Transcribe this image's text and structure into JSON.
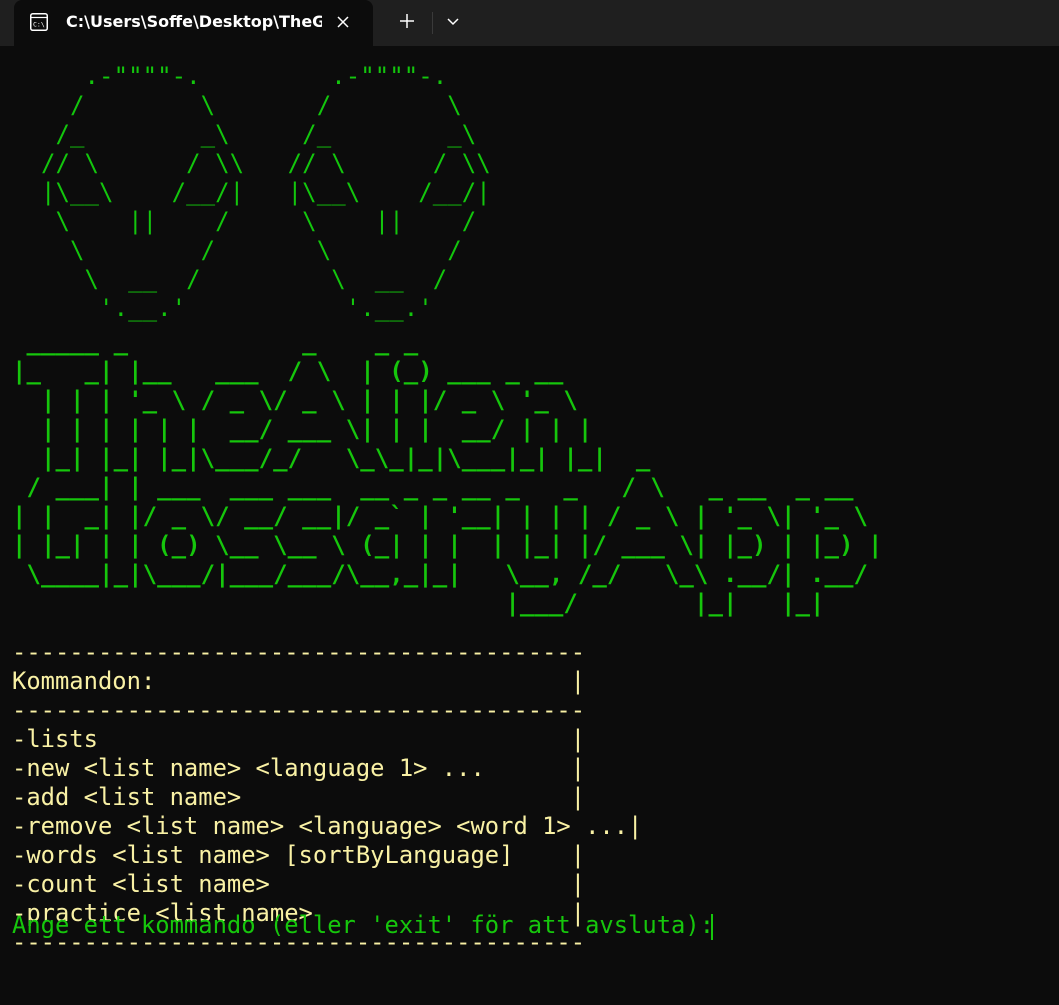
{
  "window": {
    "tab_title": "C:\\Users\\Soffe\\Desktop\\TheG",
    "tab_icon": "terminal-icon",
    "close_icon": "close-icon",
    "new_tab_icon": "plus-icon",
    "dropdown_icon": "chevron-down-icon"
  },
  "console": {
    "alien_art": "     .-\"\"\"\"-.         .-\"\"\"\"-.\n    /        \\       /        \\\n   /_        _\\     /_        _\\\n  // \\      / \\\\   // \\      / \\\\\n  |\\__\\    /__/|   |\\__\\    /__/|\n   \\    ||    /     \\    ||    /\n    \\        /       \\        /\n     \\  __  /         \\  __  /\n      '.__.'           '.__.'",
    "banner_art": " _____ _            _    _ _\n|_   _| |__   ___  / \\  | (_) ___ _ __\n  | | | '_ \\ / _ \\/ _ \\ | | |/ _ \\ '_ \\\n  | | | | | |  __/ ___ \\| | |  __/ | | |\n  |_| |_| |_|\\___/_/   \\_\\_|_|\\___|_| |_|  _\n / ___| | ___  ___ ___  __ _ _ __ _   _   / \\   _ __  _ __\n| |  _| |/ _ \\/ __/ __|/ _` | '__| | | | / _ \\ | '_ \\| '_ \\\n| |_| | | (_) \\__ \\__ \\ (_| | |  | |_| |/ ___ \\| |_) | |_) |\n \\____|_|\\___/|___/___/\\__,_|_|   \\__, /_/   \\_\\ .__/| .__/\n                                  |___/        |_|   |_|",
    "menu_lines": [
      "----------------------------------------",
      "Kommandon:                             |",
      "----------------------------------------",
      "-lists                                 |",
      "-new <list name> <language 1> ...      |",
      "-add <list name>                       |",
      "-remove <list name> <language> <word 1> ...|",
      "-words <list name> [sortByLanguage]    |",
      "-count <list name>                     |",
      "-practice <list name>                  |",
      "----------------------------------------"
    ],
    "prompt": "Ange ett kommando (eller 'exit' för att avsluta): "
  },
  "colors": {
    "background": "#0c0c0c",
    "titlebar": "#1f1f1f",
    "green": "#16c60c",
    "yellow": "#f9f1a5"
  }
}
